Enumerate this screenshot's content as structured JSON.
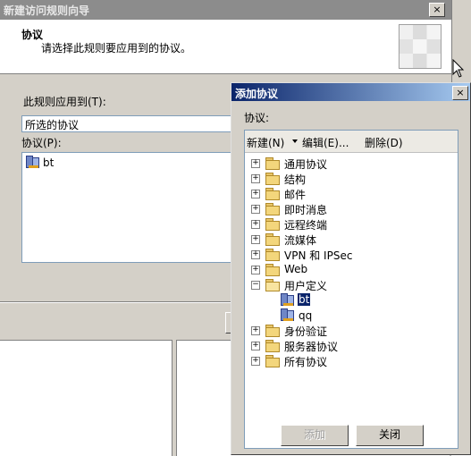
{
  "wizard": {
    "title": "新建访问规则向导",
    "close": "×",
    "header_title": "协议",
    "header_subtitle": "请选择此规则要应用到的协议。",
    "apply_label": "此规则应用到(T):",
    "apply_value": "所选的协议",
    "protocols_label": "协议(P):",
    "protocol_items": [
      "bt"
    ]
  },
  "dialog": {
    "title": "添加协议",
    "close": "×",
    "protocols_label": "协议:",
    "toolbar": {
      "new": "新建(N)",
      "edit": "编辑(E)...",
      "delete": "删除(D)"
    },
    "tree": {
      "general": "通用协议",
      "structure": "结构",
      "mail": "邮件",
      "im": "即时消息",
      "remote": "远程终端",
      "streaming": "流媒体",
      "vpn": "VPN 和 IPSec",
      "web": "Web",
      "user_defined": "用户定义",
      "user_bt": "bt",
      "user_qq": "qq",
      "auth": "身份验证",
      "server": "服务器协议",
      "all": "所有协议"
    },
    "expand_plus": "+",
    "expand_minus": "−",
    "add_button": "添加",
    "close_button": "关闭"
  }
}
